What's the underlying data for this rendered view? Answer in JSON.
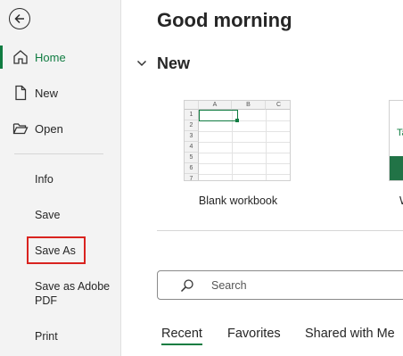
{
  "sidebar": {
    "items": [
      {
        "label": "Home",
        "icon": "home-icon"
      },
      {
        "label": "New",
        "icon": "new-document-icon"
      },
      {
        "label": "Open",
        "icon": "open-folder-icon"
      }
    ],
    "secondary": [
      "Info",
      "Save",
      "Save As",
      "Save as Adobe PDF",
      "Print"
    ]
  },
  "main": {
    "greeting": "Good morning",
    "new_section_title": "New",
    "templates": [
      {
        "label": "Blank workbook"
      },
      {
        "label": "W",
        "title_fragment": "Ta"
      }
    ],
    "blank_thumb": {
      "columns": [
        "A",
        "B",
        "C"
      ],
      "rows": [
        "1",
        "2",
        "3",
        "4",
        "5",
        "6",
        "7"
      ]
    },
    "search": {
      "placeholder": "Search"
    },
    "tabs": [
      "Recent",
      "Favorites",
      "Shared with Me"
    ]
  },
  "colors": {
    "accent": "#107c41",
    "highlight_box": "#d9231f"
  }
}
